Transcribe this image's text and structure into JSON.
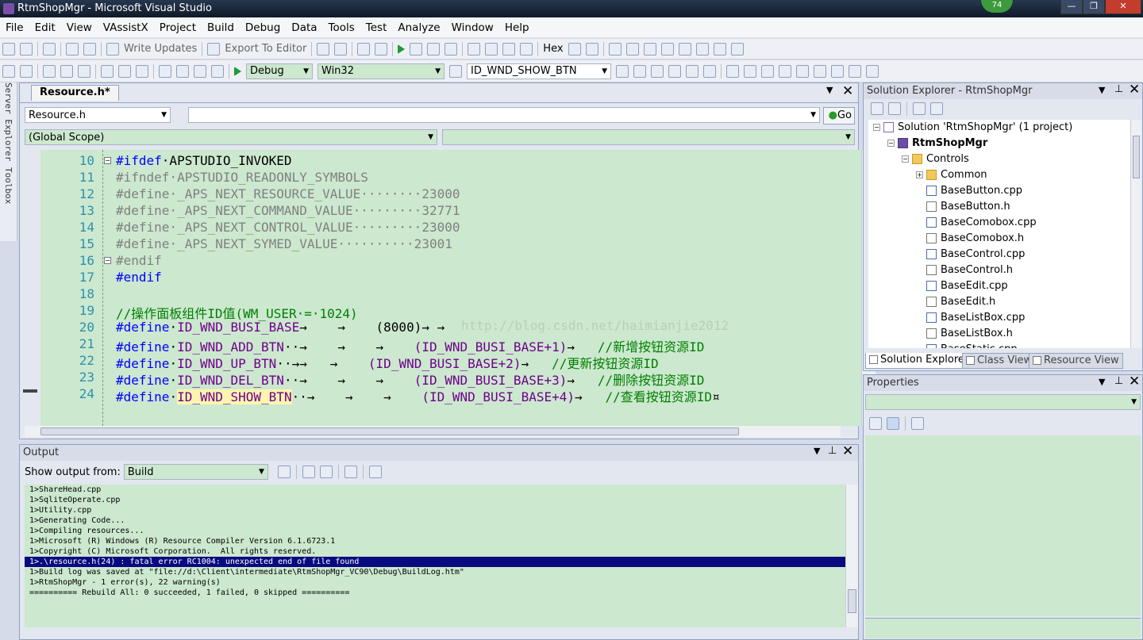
{
  "window": {
    "title": "RtmShopMgr - Microsoft Visual Studio",
    "badge": "74"
  },
  "menu": [
    "File",
    "Edit",
    "View",
    "VAssistX",
    "Project",
    "Build",
    "Debug",
    "Data",
    "Tools",
    "Test",
    "Analyze",
    "Window",
    "Help"
  ],
  "toolbar1": {
    "write_updates": "Write Updates",
    "export_to_editor": "Export To Editor",
    "hex": "Hex"
  },
  "toolbar2": {
    "config": "Debug",
    "platform": "Win32",
    "find": "ID_WND_SHOW_BTN"
  },
  "editor": {
    "tab": "Resource.h*",
    "file_combo": "Resource.h",
    "go": "Go",
    "scope": "(Global Scope)",
    "watermark": "http://blog.csdn.net/haimianjie2012",
    "lines": [
      {
        "n": "10",
        "parts": [
          {
            "c": "kw",
            "t": "#ifdef"
          },
          {
            "c": "",
            "t": "·APSTUDIO_INVOKED"
          }
        ]
      },
      {
        "n": "11",
        "parts": [
          {
            "c": "gray",
            "t": "#ifndef·APSTUDIO_READONLY_SYMBOLS"
          }
        ]
      },
      {
        "n": "12",
        "parts": [
          {
            "c": "gray",
            "t": "#define·_APS_NEXT_RESOURCE_VALUE········23000"
          }
        ]
      },
      {
        "n": "13",
        "parts": [
          {
            "c": "gray",
            "t": "#define·_APS_NEXT_COMMAND_VALUE·········32771"
          }
        ]
      },
      {
        "n": "14",
        "parts": [
          {
            "c": "gray",
            "t": "#define·_APS_NEXT_CONTROL_VALUE·········23000"
          }
        ]
      },
      {
        "n": "15",
        "parts": [
          {
            "c": "gray",
            "t": "#define·_APS_NEXT_SYMED_VALUE··········23001"
          }
        ]
      },
      {
        "n": "16",
        "parts": [
          {
            "c": "gray",
            "t": "#endif"
          }
        ]
      },
      {
        "n": "17",
        "parts": [
          {
            "c": "kw",
            "t": "#endif"
          }
        ]
      },
      {
        "n": "18",
        "parts": []
      },
      {
        "n": "19",
        "parts": [
          {
            "c": "cm",
            "t": "//操作面板组件ID值(WM_USER·=·1024)"
          }
        ]
      },
      {
        "n": "20",
        "parts": [
          {
            "c": "kw",
            "t": "#define"
          },
          {
            "c": "",
            "t": "·"
          },
          {
            "c": "mac",
            "t": "ID_WND_BUSI_BASE"
          },
          {
            "c": "",
            "t": "→    →    (8000)→ →"
          }
        ]
      },
      {
        "n": "21",
        "parts": [
          {
            "c": "kw",
            "t": "#define"
          },
          {
            "c": "",
            "t": "·"
          },
          {
            "c": "mac",
            "t": "ID_WND_ADD_BTN"
          },
          {
            "c": "",
            "t": "··→    →    →    "
          },
          {
            "c": "mac",
            "t": "(ID_WND_BUSI_BASE+1)"
          },
          {
            "c": "",
            "t": "→   "
          },
          {
            "c": "cm",
            "t": "//新增按钮资源ID"
          }
        ]
      },
      {
        "n": "22",
        "parts": [
          {
            "c": "kw",
            "t": "#define"
          },
          {
            "c": "",
            "t": "·"
          },
          {
            "c": "mac",
            "t": "ID_WND_UP_BTN"
          },
          {
            "c": "",
            "t": "··→→   →    "
          },
          {
            "c": "mac",
            "t": "(ID_WND_BUSI_BASE+2)"
          },
          {
            "c": "",
            "t": "→   "
          },
          {
            "c": "cm",
            "t": "//更新按钮资源ID"
          }
        ]
      },
      {
        "n": "23",
        "parts": [
          {
            "c": "kw",
            "t": "#define"
          },
          {
            "c": "",
            "t": "·"
          },
          {
            "c": "mac",
            "t": "ID_WND_DEL_BTN"
          },
          {
            "c": "",
            "t": "··→    →    →    "
          },
          {
            "c": "mac",
            "t": "(ID_WND_BUSI_BASE+3)"
          },
          {
            "c": "",
            "t": "→   "
          },
          {
            "c": "cm",
            "t": "//删除按钮资源ID"
          }
        ]
      },
      {
        "n": "24",
        "parts": [
          {
            "c": "kw",
            "t": "#define"
          },
          {
            "c": "",
            "t": "·"
          },
          {
            "c": "mac hl",
            "t": "ID_WND_SHOW_BTN"
          },
          {
            "c": "",
            "t": "··→    →    →    "
          },
          {
            "c": "mac",
            "t": "(ID_WND_BUSI_BASE+4)"
          },
          {
            "c": "",
            "t": "→   "
          },
          {
            "c": "cm",
            "t": "//查看按钮资源ID"
          },
          {
            "c": "",
            "t": "¤"
          }
        ]
      }
    ]
  },
  "output": {
    "title": "Output",
    "show_from_label": "Show output from:",
    "show_from_value": "Build",
    "lines": [
      "1>ShareHead.cpp",
      "1>SqliteOperate.cpp",
      "1>Utility.cpp",
      "1>Generating Code...",
      "1>Compiling resources...",
      "1>Microsoft (R) Windows (R) Resource Compiler Version 6.1.6723.1",
      "1>Copyright (C) Microsoft Corporation.  All rights reserved.",
      "1>.\\resource.h(24) : fatal error RC1004: unexpected end of file found",
      "1>Build log was saved at \"file://d:\\Client\\intermediate\\RtmShopMgr_VC90\\Debug\\BuildLog.htm\"",
      "1>RtmShopMgr - 1 error(s), 22 warning(s)",
      "========== Rebuild All: 0 succeeded, 1 failed, 0 skipped =========="
    ],
    "selected_index": 7
  },
  "solution": {
    "title": "Solution Explorer - RtmShopMgr",
    "items": [
      {
        "label": "Solution 'RtmShopMgr' (1 project)",
        "type": "sln",
        "level": 0
      },
      {
        "label": "RtmShopMgr",
        "type": "proj",
        "level": 1,
        "bold": true
      },
      {
        "label": "Controls",
        "type": "fold",
        "level": 2
      },
      {
        "label": "Common",
        "type": "fold",
        "level": 3
      },
      {
        "label": "BaseButton.cpp",
        "type": "cpp",
        "level": 3
      },
      {
        "label": "BaseButton.h",
        "type": "hf",
        "level": 3
      },
      {
        "label": "BaseComobox.cpp",
        "type": "cpp",
        "level": 3
      },
      {
        "label": "BaseComobox.h",
        "type": "hf",
        "level": 3
      },
      {
        "label": "BaseControl.cpp",
        "type": "cpp",
        "level": 3
      },
      {
        "label": "BaseControl.h",
        "type": "hf",
        "level": 3
      },
      {
        "label": "BaseEdit.cpp",
        "type": "cpp",
        "level": 3
      },
      {
        "label": "BaseEdit.h",
        "type": "hf",
        "level": 3
      },
      {
        "label": "BaseListBox.cpp",
        "type": "cpp",
        "level": 3
      },
      {
        "label": "BaseListBox.h",
        "type": "hf",
        "level": 3
      },
      {
        "label": "BaseStatic.cpp",
        "type": "cpp",
        "level": 3
      }
    ],
    "tabs": [
      "Solution Explorer",
      "Class View",
      "Resource View"
    ]
  },
  "properties": {
    "title": "Properties"
  },
  "side_tabs": {
    "server_explorer": "Server Explorer",
    "toolbox": "Toolbox"
  },
  "colors": {
    "editor_bg": "#cce8cf",
    "keyword": "#0000ff",
    "macro": "#6f008a",
    "comment": "#008000",
    "line_number": "#2b91af",
    "selection": "#0a0a80"
  }
}
